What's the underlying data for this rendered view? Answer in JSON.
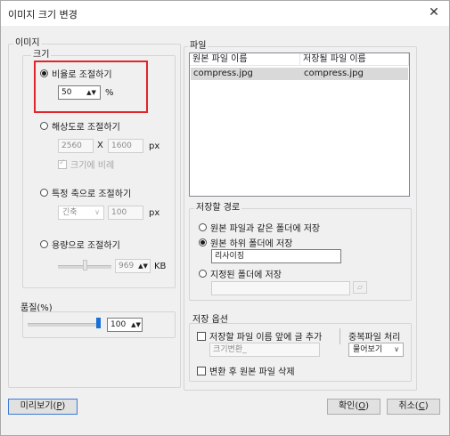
{
  "window": {
    "title": "이미지 크기 변경"
  },
  "image_group": {
    "label": "이미지",
    "size_group": {
      "label": "크기",
      "by_ratio": {
        "label": "비율로 조절하기",
        "value": "50",
        "unit": "%",
        "selected": true
      },
      "by_resolution": {
        "label": "해상도로 조절하기",
        "width": "2560",
        "times": "X",
        "height": "1600",
        "unit": "px",
        "proportional_label": "크기에 비례"
      },
      "by_axis": {
        "label": "특정 축으로 조절하기",
        "axis": "긴축",
        "value": "100",
        "unit": "px"
      },
      "by_filesize": {
        "label": "용량으로 조절하기",
        "value": "969",
        "unit": "KB"
      }
    },
    "quality": {
      "label": "품질(%)",
      "value": "100"
    }
  },
  "file_group": {
    "label": "파일",
    "columns": [
      "원본 파일 이름",
      "저장될 파일 이름"
    ],
    "rows": [
      {
        "original": "compress.jpg",
        "saved": "compress.jpg"
      }
    ]
  },
  "save_path": {
    "label": "저장할 경로",
    "same_folder": "원본 파일과 같은 폴더에 저장",
    "subfolder": "원본 하위 폴더에 저장",
    "subfolder_name": "리사이징",
    "custom_folder": "지정된 폴더에 저장",
    "custom_folder_value": ""
  },
  "save_options": {
    "label": "저장 옵션",
    "prefix_label": "저장할 파일 이름 앞에 글 추가",
    "prefix_value": "크기변환_",
    "duplicate_label": "중복파일 처리",
    "duplicate_value": "물어보기",
    "delete_label": "변환 후 원본 파일 삭제"
  },
  "buttons": {
    "preview": "미리보기",
    "preview_key": "P",
    "ok": "확인",
    "ok_key": "O",
    "cancel": "취소",
    "cancel_key": "C"
  },
  "colors": {
    "highlight": "#e0262b",
    "quality_thumb": "#1a6fd6"
  }
}
